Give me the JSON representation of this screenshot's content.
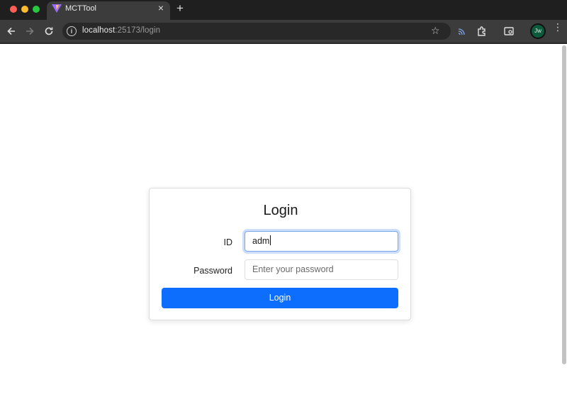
{
  "browser": {
    "tab_title": "MCTTool",
    "tab_close": "×",
    "new_tab": "+",
    "url_host": "localhost",
    "url_rest": ":25173/login",
    "info_glyph": "i",
    "star_glyph": "☆",
    "avatar_initials": "Jw",
    "menu_glyph": "⋮"
  },
  "login": {
    "title": "Login",
    "id_label": "ID",
    "id_value": "adm",
    "password_label": "Password",
    "password_placeholder": "Enter your password",
    "submit_label": "Login",
    "accent_color": "#0d6efd"
  },
  "icons": [
    "back-arrow-icon",
    "forward-arrow-icon",
    "reload-icon",
    "site-info-icon",
    "bookmark-star-icon",
    "cast-icon",
    "extensions-icon",
    "tab-search-icon",
    "profile-avatar",
    "menu-icon"
  ]
}
